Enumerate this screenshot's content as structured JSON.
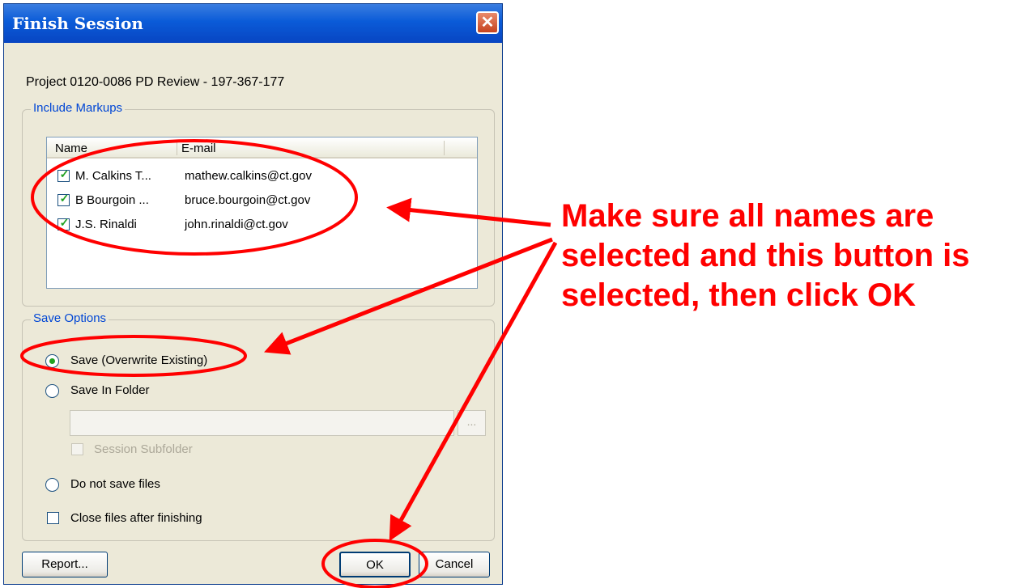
{
  "dialog": {
    "title": "Finish Session",
    "project": "Project 0120-0086 PD Review - 197-367-177"
  },
  "include_markups": {
    "legend": "Include Markups",
    "columns": [
      "Name",
      "E-mail"
    ],
    "rows": [
      {
        "name": "M. Calkins T...",
        "email": "mathew.calkins@ct.gov",
        "checked": true
      },
      {
        "name": "B Bourgoin ...",
        "email": "bruce.bourgoin@ct.gov",
        "checked": true
      },
      {
        "name": "J.S. Rinaldi",
        "email": "john.rinaldi@ct.gov",
        "checked": true
      }
    ]
  },
  "save_options": {
    "legend": "Save Options",
    "overwrite_label": "Save (Overwrite Existing)",
    "folder_label": "Save In Folder",
    "folder_path": "",
    "browse_label": "...",
    "subfolder_label": "Session Subfolder",
    "no_save_label": "Do not save files",
    "close_label": "Close files after finishing",
    "selected": "overwrite"
  },
  "buttons": {
    "report": "Report...",
    "ok": "OK",
    "cancel": "Cancel"
  },
  "annotation": {
    "text": "Make sure all names are selected and this button is selected, then click OK",
    "color": "#ff0000"
  },
  "colors": {
    "titlebar": "#0a5bd8",
    "check": "#21a121",
    "legend_text": "#0046d5"
  }
}
